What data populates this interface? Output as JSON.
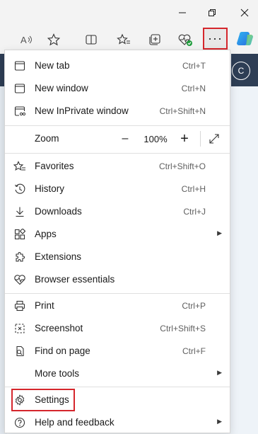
{
  "window": {
    "minimize_icon": "minimize-icon",
    "restore_icon": "restore-icon",
    "close_icon": "close-icon"
  },
  "toolbar": {
    "icons": [
      "read-aloud-icon",
      "favorite-star-icon",
      "split-screen-icon",
      "favorites-icon",
      "collections-icon",
      "browser-essentials-icon"
    ],
    "more_label": "···"
  },
  "page": {
    "avatar_letter": "C"
  },
  "menu": {
    "items": [
      {
        "label": "New tab",
        "shortcut": "Ctrl+T",
        "icon": "new-tab-icon"
      },
      {
        "label": "New window",
        "shortcut": "Ctrl+N",
        "icon": "new-window-icon"
      },
      {
        "label": "New InPrivate window",
        "shortcut": "Ctrl+Shift+N",
        "icon": "inprivate-icon"
      },
      {
        "label": "Zoom",
        "zoom_value": "100%",
        "zoom_minus": "–",
        "zoom_plus": "+",
        "icon": "fullscreen-icon"
      },
      {
        "label": "Favorites",
        "shortcut": "Ctrl+Shift+O",
        "icon": "favorites-icon"
      },
      {
        "label": "History",
        "shortcut": "Ctrl+H",
        "icon": "history-icon"
      },
      {
        "label": "Downloads",
        "shortcut": "Ctrl+J",
        "icon": "download-icon"
      },
      {
        "label": "Apps",
        "shortcut": "",
        "icon": "apps-icon",
        "submenu": true
      },
      {
        "label": "Extensions",
        "shortcut": "",
        "icon": "extensions-icon"
      },
      {
        "label": "Browser essentials",
        "shortcut": "",
        "icon": "heart-pulse-icon"
      },
      {
        "label": "Print",
        "shortcut": "Ctrl+P",
        "icon": "print-icon"
      },
      {
        "label": "Screenshot",
        "shortcut": "Ctrl+Shift+S",
        "icon": "screenshot-icon"
      },
      {
        "label": "Find on page",
        "shortcut": "Ctrl+F",
        "icon": "find-icon"
      },
      {
        "label": "More tools",
        "shortcut": "",
        "icon": "",
        "submenu": true
      },
      {
        "label": "Settings",
        "shortcut": "",
        "icon": "settings-gear-icon"
      },
      {
        "label": "Help and feedback",
        "shortcut": "",
        "icon": "help-icon",
        "submenu": true
      }
    ]
  },
  "colors": {
    "highlight_red": "#d5262c",
    "titlebar_bg": "#f3f3f3",
    "page_header_dark": "#2e3e55"
  }
}
